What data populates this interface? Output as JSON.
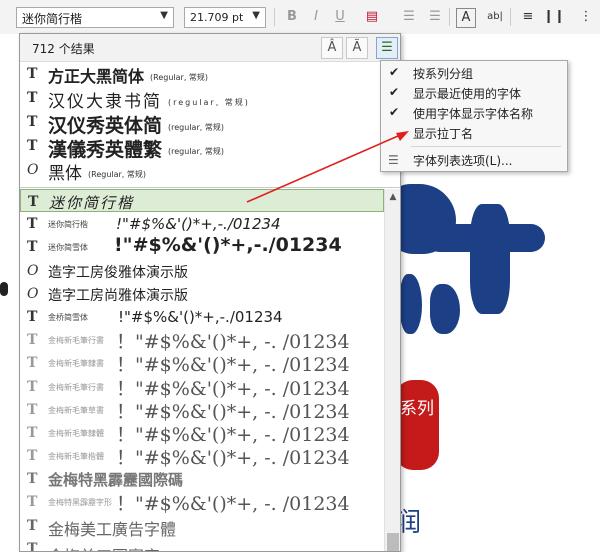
{
  "toolbar": {
    "font_value": "迷你简行楷",
    "size_value": "21.709 pt",
    "icons": [
      "bold-icon",
      "italic-icon",
      "underline-icon",
      "text-color-icon",
      "bullet-list-icon",
      "numbered-list-icon",
      "frame-text-icon",
      "text-size-icon",
      "columns-icon",
      "tabs-icon"
    ]
  },
  "font_list": {
    "result_count": "712 个结果",
    "recent": [
      {
        "name": "方正大黑简体",
        "style": "(Regular, 常规)"
      },
      {
        "name": "汉仪大隶书简",
        "style": "(regular, 常规)"
      },
      {
        "name": "汉仪秀英体简",
        "style": "(regular, 常规)"
      },
      {
        "name": "漢儀秀英體繁",
        "style": "(regular, 常规)"
      },
      {
        "name": "黑体",
        "style": "(Regular, 常规)"
      }
    ],
    "fonts": [
      {
        "name": "迷你简行楷",
        "sample": "",
        "sel": true
      },
      {
        "name": "迷你简行楷",
        "sample": "!\"#$%&'()*+,-./01234"
      },
      {
        "name": "迷你简雪体",
        "sample": "!\"#$%&'()*+,-./01234"
      },
      {
        "name": "造字工房俊雅体演示版",
        "sample": ""
      },
      {
        "name": "造字工房尚雅体演示版",
        "sample": ""
      },
      {
        "name": "金桥简雪体",
        "sample": "!\"#$%&'()*+,-./01234"
      },
      {
        "name": "金梅新毛筆行書",
        "sample": "！\"#$%&'()*+, -. /01234"
      },
      {
        "name": "金梅新毛筆隸書",
        "sample": "！\"#$%&'()*+, -. /01234"
      },
      {
        "name": "金梅新毛筆行書",
        "sample": "！\"#$%&'()*+, -. /01234"
      },
      {
        "name": "金梅新毛筆草書",
        "sample": "！\"#$%&'()*+, -. /01234"
      },
      {
        "name": "金梅新毛筆隸體",
        "sample": "！\"#$%&'()*+, -. /01234"
      },
      {
        "name": "金梅新毛筆楷體",
        "sample": "！\"#$%&'()*+, -. /01234"
      },
      {
        "name": "金梅特黑霹靂國際碼",
        "sample": ""
      },
      {
        "name": "金梅特黑霹靂字形",
        "sample": "！\"#$%&'()*+, -. /01234"
      },
      {
        "name": "金梅美工廣告字體",
        "sample": ""
      },
      {
        "name": "金梅美工圖案字",
        "sample": ""
      }
    ]
  },
  "context_menu": {
    "items": [
      {
        "label": "按系列分组",
        "checked": true
      },
      {
        "label": "显示最近使用的字体",
        "checked": true
      },
      {
        "label": "使用字体显示字体名称",
        "checked": true
      },
      {
        "label": "显示拉丁名",
        "checked": false
      },
      {
        "label": "字体列表选项(L)...",
        "checked": false
      }
    ]
  },
  "canvas": {
    "seal_text": "系列",
    "blue_char": "润"
  },
  "colors": {
    "selection_bg": "#ddecd5",
    "selection_border": "#8cb37c",
    "arrow": "#e0201a",
    "brand_blue": "#1c3f86",
    "seal_red": "#c41a1a"
  }
}
